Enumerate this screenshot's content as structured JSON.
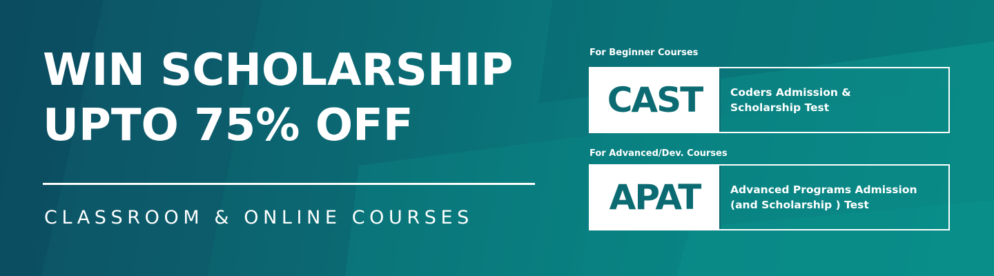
{
  "headline": {
    "line1": "WIN SCHOLARSHIP",
    "line2": "UPTO 75% OFF"
  },
  "subline": "CLASSROOM & ONLINE COURSES",
  "tests": [
    {
      "caption": "For Beginner Courses",
      "acronym": "CAST",
      "name_line1": "Coders Admission &",
      "name_line2": "Scholarship Test"
    },
    {
      "caption": "For Advanced/Dev. Courses",
      "acronym": "APAT",
      "name_line1": "Advanced Programs Admission",
      "name_line2": "(and Scholarship ) Test"
    }
  ],
  "colors": {
    "background_dark": "#0c4e62",
    "background_light": "#0a8c88",
    "text": "#ffffff",
    "acronym_text": "#0c6b72"
  }
}
